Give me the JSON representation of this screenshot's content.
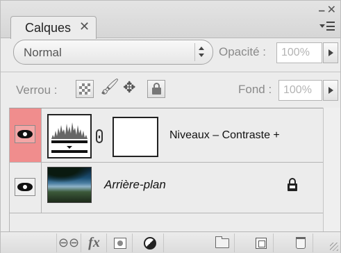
{
  "panel": {
    "tab_label": "Calques",
    "tab_close": "✕",
    "minimize": "–",
    "close": "✕"
  },
  "blend": {
    "mode": "Normal",
    "opacity_label": "Opacité :",
    "opacity_value": "100%"
  },
  "lock": {
    "label": "Verrou :",
    "fill_label": "Fond :",
    "fill_value": "100%"
  },
  "layers": [
    {
      "name": "Niveaux – Contraste +",
      "visible": true,
      "selected": true,
      "type": "adjustment-levels"
    },
    {
      "name": "Arrière-plan",
      "visible": true,
      "selected": false,
      "locked": true,
      "type": "image"
    }
  ],
  "toolbar": {
    "fx_label": "fx"
  },
  "colors": {
    "selected_eye_cell": "#f08d8d",
    "panel_bg": "#ececec"
  }
}
